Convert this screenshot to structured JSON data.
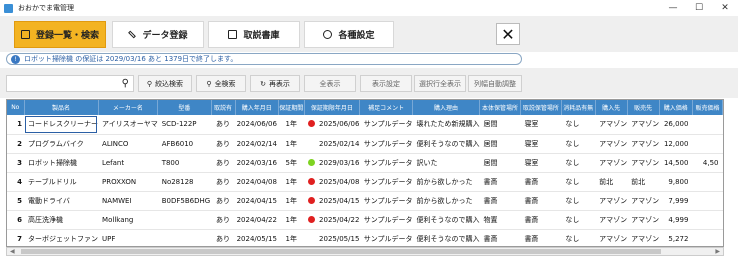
{
  "window": {
    "title": "おおかでま電管理",
    "minimize": "—",
    "maximize": "☐",
    "close": "✕"
  },
  "tabs": [
    {
      "label": "登録一覧・検索"
    },
    {
      "label": "データ登録"
    },
    {
      "label": "取説書庫"
    },
    {
      "label": "各種設定"
    }
  ],
  "close_button": "✕",
  "notice": {
    "icon": "!",
    "text": "ロボット掃除機 の保証は 2029/03/16 あと 1379日で終了します。"
  },
  "actions": {
    "search_placeholder": "",
    "narrow_search": "絞込検索",
    "all_search": "全検索",
    "re_display": "再表示",
    "all_display": "全表示",
    "display_settings": "表示設定",
    "select_all_rows": "選択行全表示",
    "auto_adjust_width": "列幅自動調整"
  },
  "colors": {
    "accent": "#f3b322",
    "header": "#3f86c6",
    "red_dot": "#e02020",
    "green_dot": "#7ed321"
  },
  "table": {
    "columns": [
      "No",
      "製品名",
      "メーカー名",
      "型番",
      "取説有",
      "購入年月日",
      "保証期間",
      "保証期限年月日",
      "補足コメント",
      "購入理由",
      "本体保管場所",
      "取説保管場所",
      "消耗品有無",
      "購入先",
      "販売先",
      "購入価格",
      "販売価格"
    ],
    "rows": [
      {
        "no": "1",
        "name": "コードレスクリーナー",
        "maker": "アイリスオーヤマ",
        "model": "SCD-122P",
        "manual": "あり",
        "date": "2024/06/06",
        "period": "1年",
        "dot": "red",
        "expire": "2025/06/06",
        "comment": "サンプルデータ",
        "reason": "壊れたため新規購入",
        "body": "居間",
        "manual_loc": "寝室",
        "consum": "なし",
        "shop": "アマゾン",
        "seller": "アマゾン",
        "price": "26,000",
        "sell": ""
      },
      {
        "no": "2",
        "name": "プログラムバイク",
        "maker": "ALINCO",
        "model": "AFB6010",
        "manual": "あり",
        "date": "2024/02/14",
        "period": "1年",
        "dot": "",
        "expire": "2025/02/14",
        "comment": "サンプルデータ",
        "reason": "便利そうなので購入",
        "body": "居間",
        "manual_loc": "寝室",
        "consum": "なし",
        "shop": "アマゾン",
        "seller": "アマゾン",
        "price": "12,000",
        "sell": ""
      },
      {
        "no": "3",
        "name": "ロボット掃除機",
        "maker": "Lefant",
        "model": "T800",
        "manual": "あり",
        "date": "2024/03/16",
        "period": "5年",
        "dot": "green",
        "expire": "2029/03/16",
        "comment": "サンプルデータ",
        "reason": "訳いた",
        "body": "居間",
        "manual_loc": "寝室",
        "consum": "なし",
        "shop": "アマゾン",
        "seller": "アマゾン",
        "price": "14,500",
        "sell": "4,50"
      },
      {
        "no": "4",
        "name": "テーブルドリル",
        "maker": "PROXXON",
        "model": "No28128",
        "manual": "あり",
        "date": "2024/04/08",
        "period": "1年",
        "dot": "red",
        "expire": "2025/04/08",
        "comment": "サンプルデータ",
        "reason": "前から欲しかった",
        "body": "書斎",
        "manual_loc": "書斎",
        "consum": "なし",
        "shop": "前北",
        "seller": "前北",
        "price": "9,800",
        "sell": ""
      },
      {
        "no": "5",
        "name": "電動ドライバ",
        "maker": "NAMWEI",
        "model": "B0DF5B6DHG",
        "manual": "あり",
        "date": "2024/04/15",
        "period": "1年",
        "dot": "red",
        "expire": "2025/04/15",
        "comment": "サンプルデータ",
        "reason": "前から欲しかった",
        "body": "書斎",
        "manual_loc": "書斎",
        "consum": "なし",
        "shop": "アマゾン",
        "seller": "アマゾン",
        "price": "7,999",
        "sell": ""
      },
      {
        "no": "6",
        "name": "高圧洗浄機",
        "maker": "Mollkang",
        "model": "",
        "manual": "あり",
        "date": "2024/04/22",
        "period": "1年",
        "dot": "red",
        "expire": "2025/04/22",
        "comment": "サンプルデータ",
        "reason": "便利そうなので購入",
        "body": "物置",
        "manual_loc": "書斎",
        "consum": "なし",
        "shop": "アマゾン",
        "seller": "アマゾン",
        "price": "4,999",
        "sell": ""
      },
      {
        "no": "7",
        "name": "ターボジェットファン",
        "maker": "UPF",
        "model": "",
        "manual": "あり",
        "date": "2024/05/15",
        "period": "1年",
        "dot": "",
        "expire": "2025/05/15",
        "comment": "サンプルデータ",
        "reason": "便利そうなので購入",
        "body": "書斎",
        "manual_loc": "書斎",
        "consum": "なし",
        "shop": "アマゾン",
        "seller": "アマゾン",
        "price": "5,272",
        "sell": ""
      }
    ]
  }
}
